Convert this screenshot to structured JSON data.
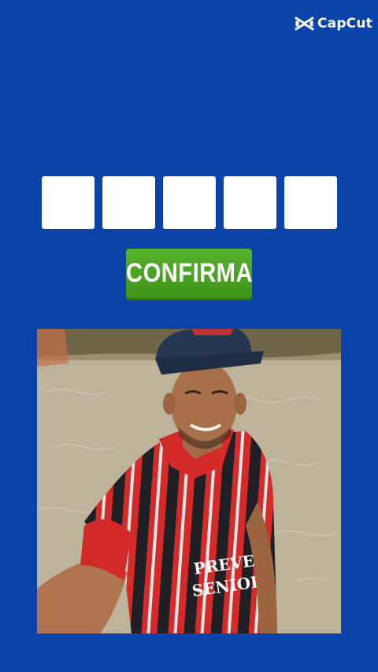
{
  "brand": {
    "name": "CapCut",
    "icon": "capcut-logo-icon"
  },
  "code_input": {
    "box_count": 5,
    "values": [
      "",
      "",
      "",
      "",
      ""
    ]
  },
  "confirm_button": {
    "label": "CONFIRMA",
    "color": "#4ca524"
  },
  "photo": {
    "shirt_text": "PREVENT SENIOR"
  },
  "colors": {
    "background": "#0b44a8",
    "box": "#ffffff",
    "button_green": "#4ca524"
  }
}
